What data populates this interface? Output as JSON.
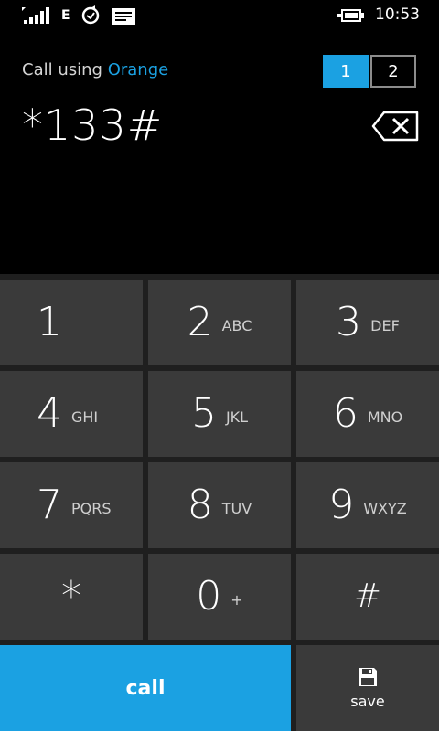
{
  "status_bar": {
    "network_type": "E",
    "time": "10:53",
    "icons": [
      "signal-strength-icon",
      "sync-icon",
      "message-icon",
      "battery-charging-icon"
    ]
  },
  "header": {
    "call_using_prefix": "Call using",
    "carrier": "Orange",
    "sim_options": [
      "1",
      "2"
    ],
    "selected_sim": "1"
  },
  "dialer": {
    "number": "*133#"
  },
  "keypad": {
    "keys": [
      {
        "digit": "1",
        "letters": ""
      },
      {
        "digit": "2",
        "letters": "ABC"
      },
      {
        "digit": "3",
        "letters": "DEF"
      },
      {
        "digit": "4",
        "letters": "GHI"
      },
      {
        "digit": "5",
        "letters": "JKL"
      },
      {
        "digit": "6",
        "letters": "MNO"
      },
      {
        "digit": "7",
        "letters": "PQRS"
      },
      {
        "digit": "8",
        "letters": "TUV"
      },
      {
        "digit": "9",
        "letters": "WXYZ"
      },
      {
        "digit": "*",
        "letters": ""
      },
      {
        "digit": "0",
        "letters": "+"
      },
      {
        "digit": "#",
        "letters": ""
      }
    ]
  },
  "actions": {
    "call_label": "call",
    "save_label": "save"
  },
  "colors": {
    "accent": "#1ba1e2",
    "key_background": "#3a3a3a",
    "background": "#000000"
  }
}
